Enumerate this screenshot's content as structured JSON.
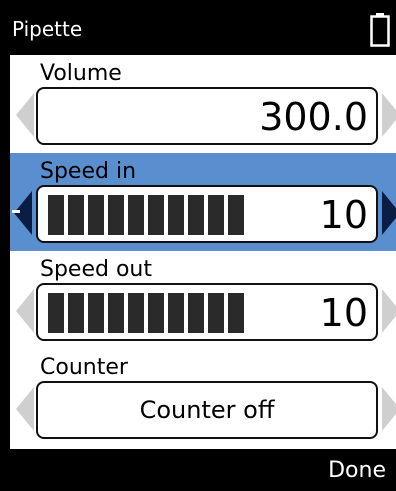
{
  "header": {
    "title": "Pipette",
    "battery_icon": "battery-icon"
  },
  "colors": {
    "selected_row": "#5a8fcf",
    "background": "#000000",
    "panel": "#ffffff",
    "active_arrow": "#0a1e45"
  },
  "settings": {
    "volume": {
      "label": "Volume",
      "value": "300.0"
    },
    "speed_in": {
      "label": "Speed in",
      "value": "10",
      "level": 10,
      "max_level": 10,
      "selected": true
    },
    "speed_out": {
      "label": "Speed out",
      "value": "10",
      "level": 10,
      "max_level": 10
    },
    "counter": {
      "label": "Counter",
      "value": "Counter off"
    }
  },
  "footer": {
    "done_label": "Done"
  }
}
